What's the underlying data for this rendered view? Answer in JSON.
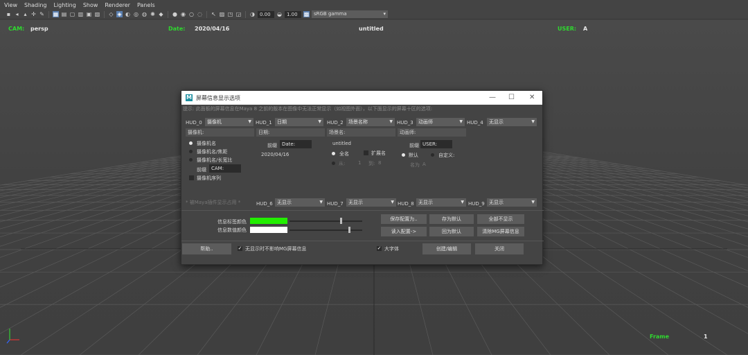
{
  "menu": [
    "View",
    "Shading",
    "Lighting",
    "Show",
    "Renderer",
    "Panels"
  ],
  "toolbar": {
    "exposure": "0.00",
    "gamma": "1.00",
    "colorspace": "sRGB gamma",
    "colors": {
      "active": "#5a7fb0"
    }
  },
  "hud": {
    "cam_key": "CAM:",
    "cam_val": "persp",
    "date_key": "Date:",
    "date_val": "2020/04/16",
    "scene": "untitled",
    "user_key": "USER:",
    "user_val": "A",
    "frame_key": "Frame",
    "frame_val": "1",
    "color": "#2fd92f"
  },
  "dialog": {
    "title": "屏幕信息显示选项",
    "hint": "提示: 此面板的屏幕信息在Maya 8 之前的版本在图像中无法正常显示（如视图外面），以下面显示的屏幕十区的选项:",
    "hud_row1": [
      {
        "label": "HUD_0",
        "value": "摄像机"
      },
      {
        "label": "HUD_1",
        "value": "日期"
      },
      {
        "label": "HUD_2",
        "value": "场景名称"
      },
      {
        "label": "HUD_3",
        "value": "动画师"
      },
      {
        "label": "HUD_4",
        "value": "无显示"
      }
    ],
    "fields_row1": [
      "摄像机:",
      "日期:",
      "场景名:",
      "动画师:"
    ],
    "camera_options": [
      "摄像机名",
      "摄像机名/焦距",
      "摄像机名/长宽比"
    ],
    "camera_prefix_label": "前缀",
    "camera_prefix_value": "CAM:",
    "camera_sequence": "摄像机序列",
    "date_prefix_label": "前缀",
    "date_prefix_value": "Date:",
    "date_value": "2020/04/16",
    "scene_value": "untitled",
    "scene_fullname": "全名",
    "scene_extension": "扩展名",
    "scene_from": "从:",
    "scene_from_val": "1",
    "scene_to": "到:",
    "scene_to_val": "8",
    "anim_prefix_label": "前缀",
    "anim_prefix_value": "USER:",
    "anim_default": "默认",
    "anim_custom": "自定义:",
    "anim_name": "名为",
    "anim_name_val": "A",
    "maya_hint": "* 被Maya插件显示占用 *",
    "hud_row2": [
      {
        "label": "HUD_6",
        "value": "无显示"
      },
      {
        "label": "HUD_7",
        "value": "无显示"
      },
      {
        "label": "HUD_8",
        "value": "无显示"
      },
      {
        "label": "HUD_9",
        "value": "无显示"
      }
    ],
    "label_color_text": "信息标签颜色",
    "value_color_text": "信息数值颜色",
    "label_color": "#22ee00",
    "value_color": "#ffffff",
    "buttons": {
      "save_config": "保存配置为..",
      "set_default": "存为默认",
      "hide_all": "全部不显示",
      "load_config": "读入配置->",
      "restore_default": "回为默认",
      "clear_mg": "清除MG屏幕信息",
      "help": "帮助..",
      "create_edit": "创建/编辑",
      "close": "关闭"
    },
    "no_affect_label": "无显示时不影响MG屏幕信息",
    "big_font_label": "大字体"
  }
}
